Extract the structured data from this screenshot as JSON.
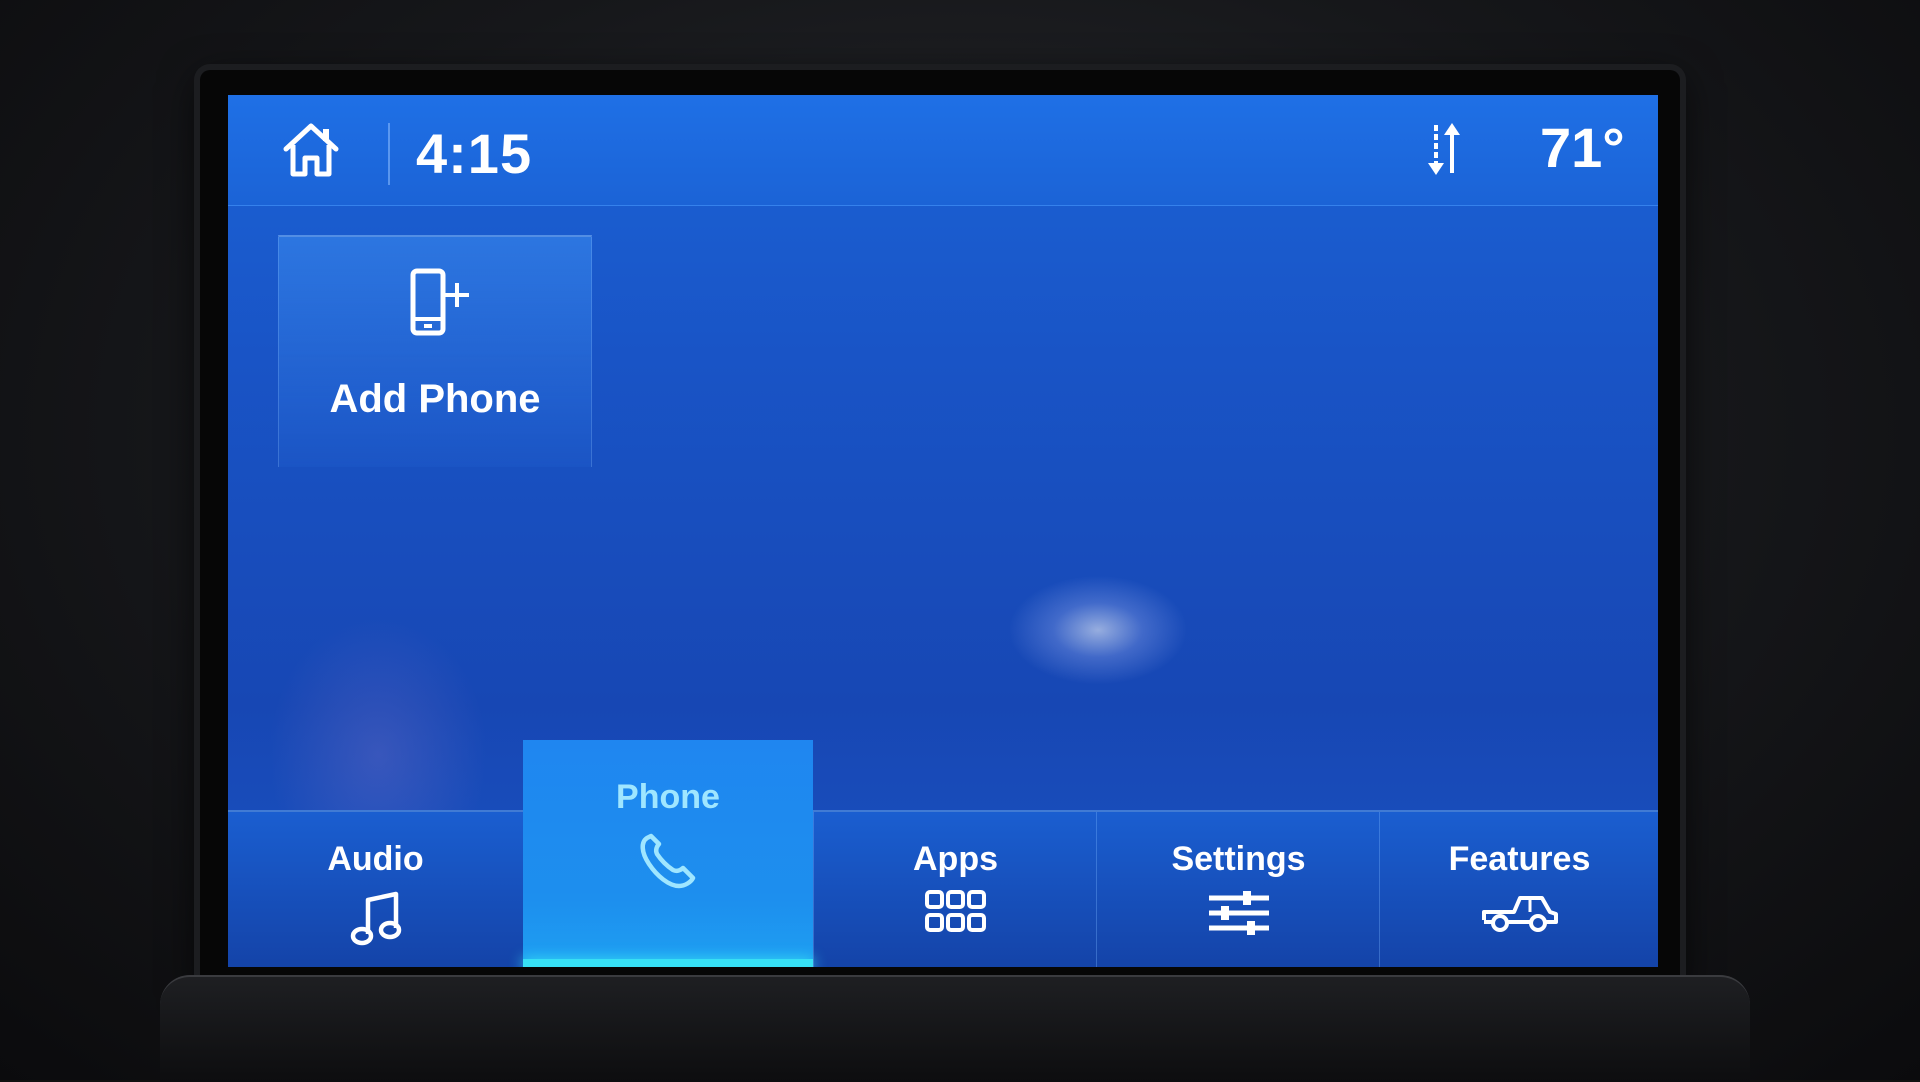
{
  "status_bar": {
    "time": "4:15",
    "temperature": "71°",
    "home_icon": "home-icon",
    "data_icon": "data-transfer-arrows-icon"
  },
  "tile": {
    "label": "Add Phone",
    "icon": "phone-add-icon"
  },
  "nav": {
    "active": "Phone",
    "items": [
      {
        "label": "Audio",
        "icon": "music-note-icon"
      },
      {
        "label": "Phone",
        "icon": "phone-handset-icon"
      },
      {
        "label": "Apps",
        "icon": "app-grid-icon"
      },
      {
        "label": "Settings",
        "icon": "sliders-icon"
      },
      {
        "label": "Features",
        "icon": "pickup-truck-icon"
      }
    ]
  },
  "colors": {
    "screen_blue": "#1954c6",
    "active_tab": "#1d8fee",
    "active_indicator": "#37e0f5",
    "active_label": "#9fe6ff"
  }
}
